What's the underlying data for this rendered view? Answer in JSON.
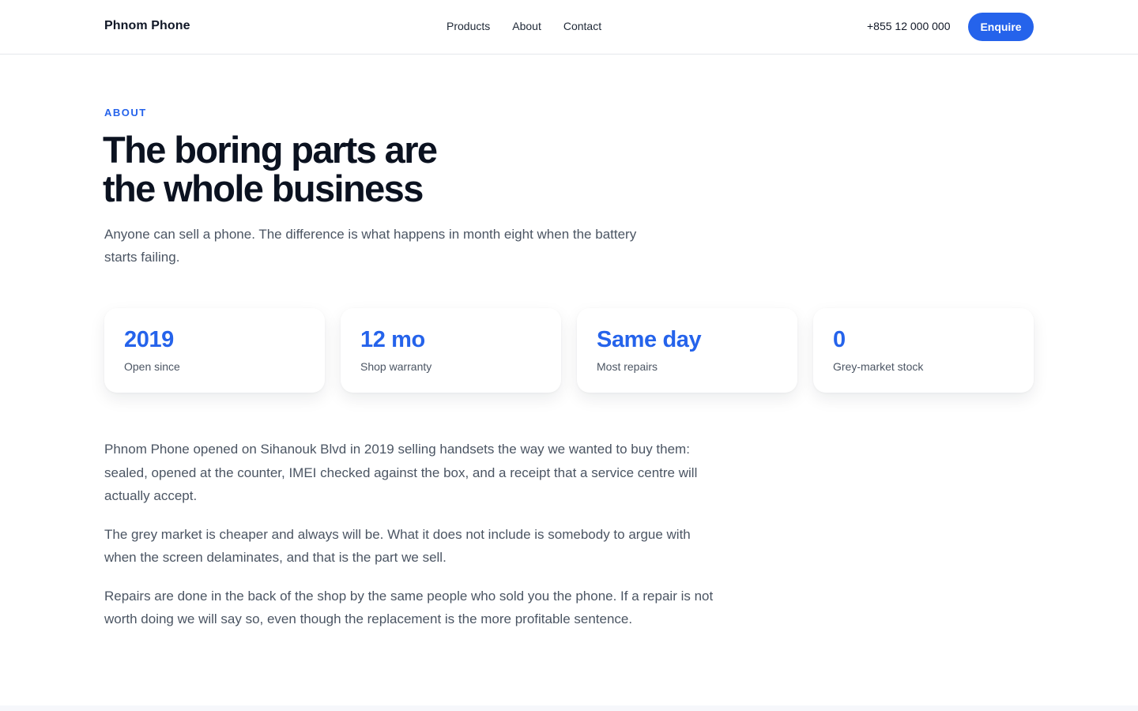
{
  "header": {
    "brand": "Phnom Phone",
    "nav": [
      "Products",
      "About",
      "Contact"
    ],
    "phone": "+855 12 000 000",
    "cta_label": "Enquire"
  },
  "hero": {
    "eyebrow": "ABOUT",
    "headline_line1": "The boring parts are",
    "headline_line2": "the whole business",
    "lede": "Anyone can sell a phone. The difference is what happens in month eight when the battery starts failing."
  },
  "stats": [
    {
      "value": "2019",
      "label": "Open since"
    },
    {
      "value": "12 mo",
      "label": "Shop warranty"
    },
    {
      "value": "Same day",
      "label": "Most repairs"
    },
    {
      "value": "0",
      "label": "Grey-market stock"
    }
  ],
  "body": [
    "Phnom Phone opened on Sihanouk Blvd in 2019 selling handsets the way we wanted to buy them: sealed, opened at the counter, IMEI checked against the box, and a receipt that a service centre will actually accept.",
    "The grey market is cheaper and always will be. What it does not include is somebody to argue with when the screen delaminates, and that is the part we sell.",
    "Repairs are done in the back of the shop by the same people who sold you the phone. If a repair is not worth doing we will say so, even though the replacement is the more profitable sentence."
  ],
  "colors": {
    "accent": "#2563eb",
    "text_dark": "#0b1220",
    "text_muted": "#4b5563"
  }
}
